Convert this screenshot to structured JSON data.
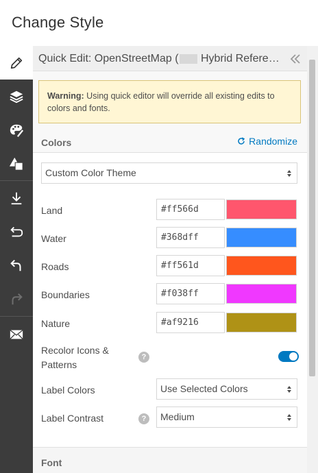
{
  "header": {
    "title": "Change Style"
  },
  "toolbar": {
    "tools": [
      {
        "icon": "pencil-icon",
        "active": true
      },
      {
        "icon": "layers-icon"
      },
      {
        "icon": "palette-icon"
      },
      {
        "icon": "shapes-icon"
      },
      {
        "icon": "download-icon"
      },
      {
        "icon": "revert-icon"
      },
      {
        "icon": "undo-icon"
      },
      {
        "icon": "redo-icon",
        "disabled": true
      },
      {
        "icon": "mail-icon"
      }
    ]
  },
  "panel": {
    "title_prefix": "Quick Edit: OpenStreetMap (",
    "title_suffix": "Hybrid Refere…",
    "warning_bold": "Warning:",
    "warning_text": " Using quick editor will override all existing edits to colors and fonts."
  },
  "colors": {
    "section_title": "Colors",
    "randomize_label": "Randomize",
    "theme_select": "Custom Color Theme",
    "rows": [
      {
        "label": "Land",
        "hex": "#ff566d",
        "color": "#ff566d"
      },
      {
        "label": "Water",
        "hex": "#368dff",
        "color": "#368dff"
      },
      {
        "label": "Roads",
        "hex": "#ff561d",
        "color": "#ff561d"
      },
      {
        "label": "Boundaries",
        "hex": "#f038ff",
        "color": "#f038ff"
      },
      {
        "label": "Nature",
        "hex": "#af9216",
        "color": "#af9216"
      }
    ],
    "recolor_label_line1": "Recolor Icons &",
    "recolor_label_line2": "Patterns",
    "recolor_enabled": true,
    "label_colors_label": "Label Colors",
    "label_colors_value": "Use Selected Colors",
    "label_contrast_label": "Label Contrast",
    "label_contrast_value": "Medium",
    "help_glyph": "?"
  },
  "font": {
    "section_title": "Font"
  },
  "accent": "#0079c1"
}
